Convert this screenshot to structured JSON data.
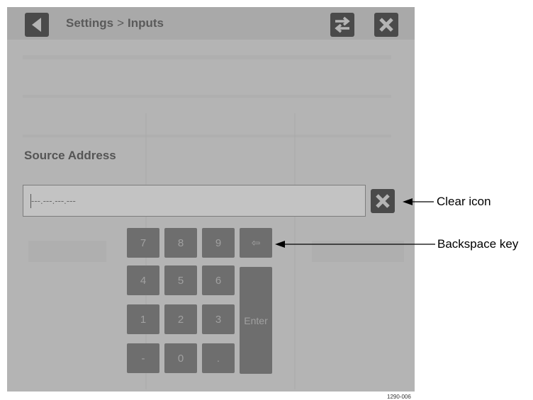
{
  "header": {
    "breadcrumb_parent": "Settings",
    "breadcrumb_separator": ">",
    "breadcrumb_current": "Inputs",
    "icons": {
      "back": "back-arrow-icon",
      "swap": "swap-arrows-icon",
      "close": "close-icon"
    }
  },
  "source_address": {
    "title": "Source Address",
    "value": "---.---.---.---",
    "clear_icon": "clear-icon"
  },
  "keypad": {
    "keys": [
      "7",
      "8",
      "9",
      "⇦",
      "4",
      "5",
      "6",
      "1",
      "2",
      "3",
      "-",
      "0",
      "."
    ],
    "enter_label": "Enter"
  },
  "callouts": {
    "clear": "Clear icon",
    "backspace": "Backspace key"
  },
  "figure_id": "1290-006",
  "colors": {
    "overlay": "#b4b4b4",
    "button_dark": "#4a4a4a",
    "key": "#6e6e6e",
    "key_text": "#a0a0a0"
  }
}
